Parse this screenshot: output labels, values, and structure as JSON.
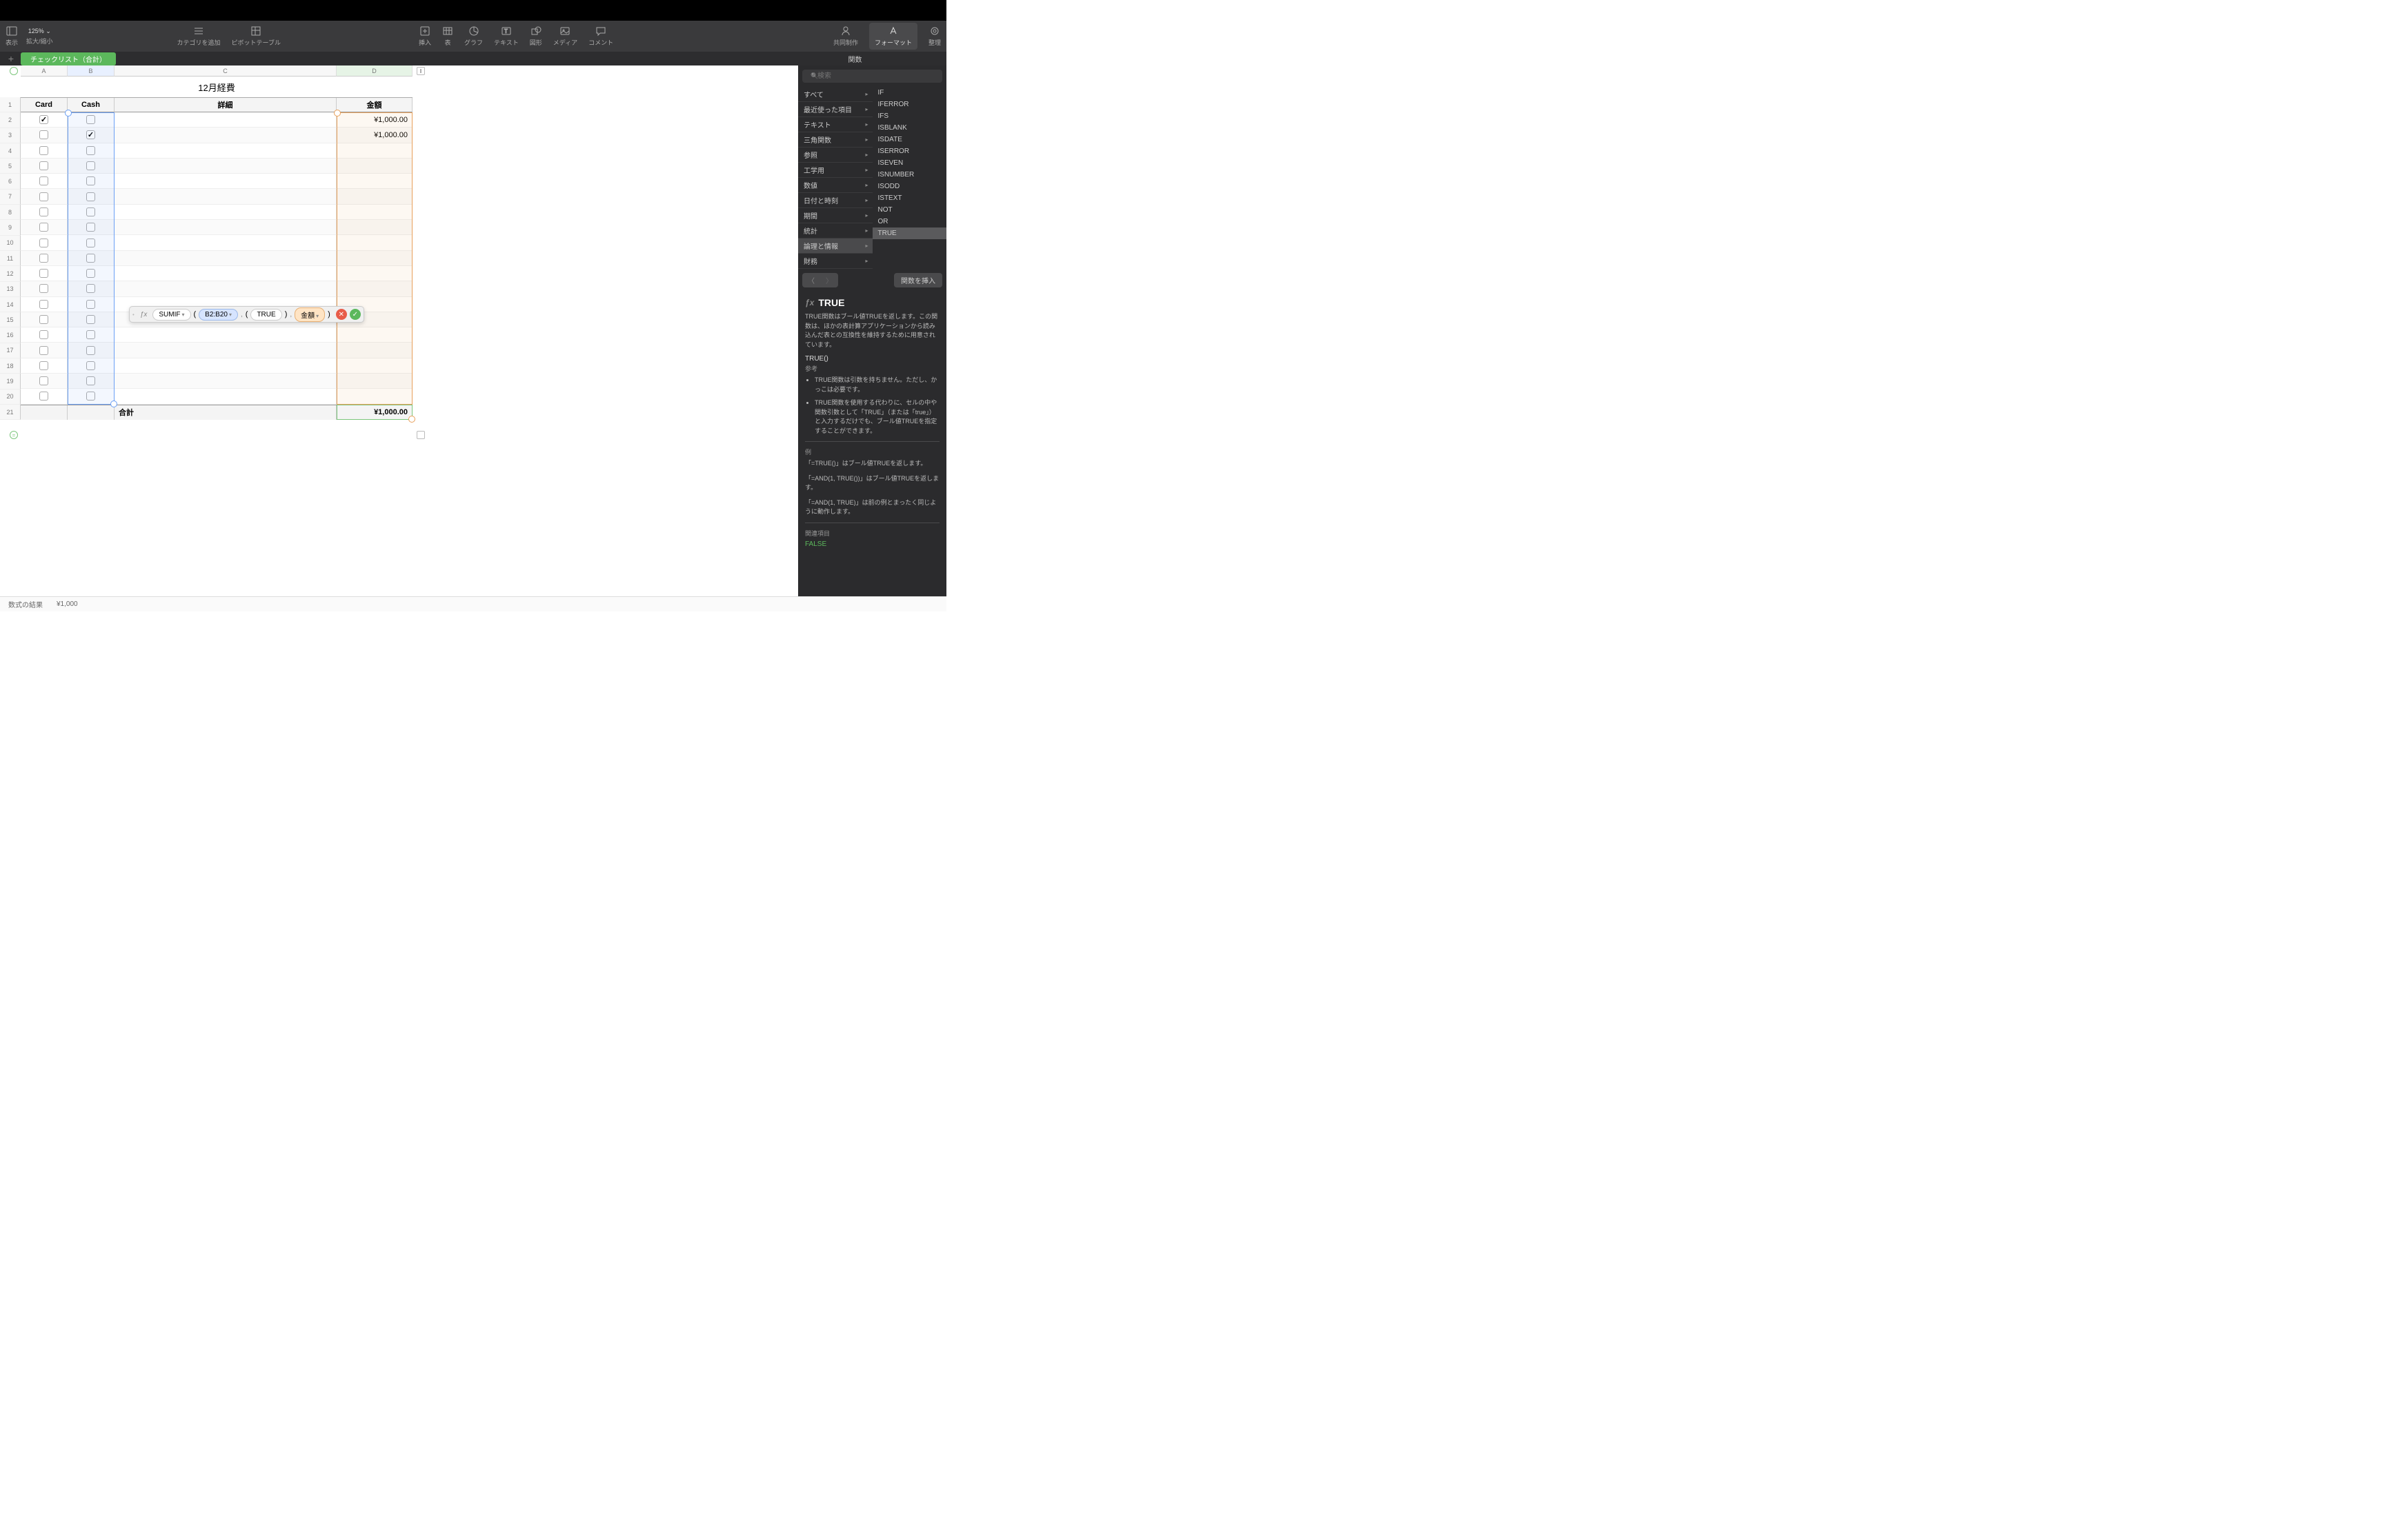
{
  "toolbar": {
    "view_label": "表示",
    "zoom": "125%",
    "zoom_label": "拡大/縮小",
    "category": "カテゴリを追加",
    "pivot": "ピボットテーブル",
    "insert": "挿入",
    "table": "表",
    "chart": "グラフ",
    "text": "テキスト",
    "shape": "図形",
    "media": "メディア",
    "comment": "コメント",
    "collab": "共同制作",
    "format": "フォーマット",
    "organize": "整理"
  },
  "tabbar": {
    "sheet_name": "チェックリスト（合計）",
    "func_header": "関数"
  },
  "table": {
    "title": "12月経費",
    "cols": {
      "A": "Card",
      "B": "Cash",
      "C": "詳細",
      "D": "金額"
    },
    "col_letters": [
      "A",
      "B",
      "C",
      "D"
    ],
    "rows": [
      {
        "a": true,
        "b": false,
        "c": "",
        "d": "¥1,000.00"
      },
      {
        "a": false,
        "b": true,
        "c": "",
        "d": "¥1,000.00"
      },
      {
        "a": false,
        "b": false,
        "c": "",
        "d": ""
      },
      {
        "a": false,
        "b": false,
        "c": "",
        "d": ""
      },
      {
        "a": false,
        "b": false,
        "c": "",
        "d": ""
      },
      {
        "a": false,
        "b": false,
        "c": "",
        "d": ""
      },
      {
        "a": false,
        "b": false,
        "c": "",
        "d": ""
      },
      {
        "a": false,
        "b": false,
        "c": "",
        "d": ""
      },
      {
        "a": false,
        "b": false,
        "c": "",
        "d": ""
      },
      {
        "a": false,
        "b": false,
        "c": "",
        "d": ""
      },
      {
        "a": false,
        "b": false,
        "c": "",
        "d": ""
      },
      {
        "a": false,
        "b": false,
        "c": "",
        "d": ""
      },
      {
        "a": false,
        "b": false,
        "c": "",
        "d": ""
      },
      {
        "a": false,
        "b": false,
        "c": "",
        "d": ""
      },
      {
        "a": false,
        "b": false,
        "c": "",
        "d": ""
      },
      {
        "a": false,
        "b": false,
        "c": "",
        "d": ""
      },
      {
        "a": false,
        "b": false,
        "c": "",
        "d": ""
      },
      {
        "a": false,
        "b": false,
        "c": "",
        "d": ""
      },
      {
        "a": false,
        "b": false,
        "c": "",
        "d": ""
      }
    ],
    "footer": {
      "label": "合計",
      "value": "¥1,000.00"
    }
  },
  "formula": {
    "fn": "SUMIF",
    "range": "B2:B20",
    "cond": "TRUE",
    "sumcol": "金額"
  },
  "panel": {
    "search_placeholder": "検索",
    "categories": [
      "すべて",
      "最近使った項目",
      "テキスト",
      "三角関数",
      "参照",
      "工学用",
      "数値",
      "日付と時刻",
      "期間",
      "統計",
      "論理と情報",
      "財務"
    ],
    "selected_category": "論理と情報",
    "functions": [
      "IF",
      "IFERROR",
      "IFS",
      "ISBLANK",
      "ISDATE",
      "ISERROR",
      "ISEVEN",
      "ISNUMBER",
      "ISODD",
      "ISTEXT",
      "NOT",
      "OR",
      "TRUE"
    ],
    "selected_function": "TRUE",
    "insert_label": "関数を挿入",
    "doc": {
      "title": "TRUE",
      "desc": "TRUE関数はブール値TRUEを返します。この関数は、ほかの表計算アプリケーションから読み込んだ表との互換性を維持するために用意されています。",
      "signature": "TRUE()",
      "ref_label": "参考",
      "notes": [
        "TRUE関数は引数を持ちません。ただし、かっこは必要です。",
        "TRUE関数を使用する代わりに、セルの中や関数引数として「TRUE」（または「true」）と入力するだけでも、ブール値TRUEを指定することができます。"
      ],
      "examples_label": "例",
      "examples": [
        "「=TRUE()」はブール値TRUEを返します。",
        "「=AND(1, TRUE())」はブール値TRUEを返します。",
        "「=AND(1, TRUE)」は前の例とまったく同じように動作します。"
      ],
      "related_label": "関連項目",
      "related": "FALSE"
    }
  },
  "status": {
    "label": "数式の結果",
    "value": "¥1,000"
  }
}
